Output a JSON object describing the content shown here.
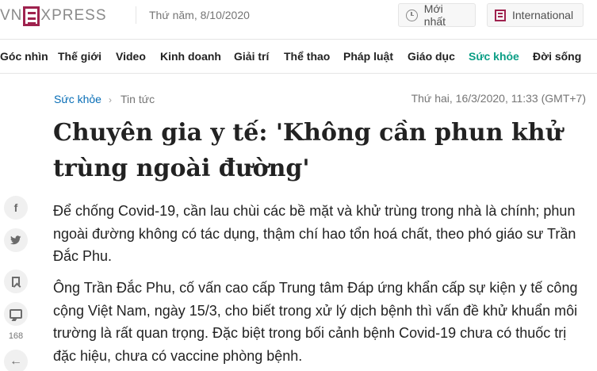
{
  "header": {
    "logo": {
      "left": "VN",
      "right": "XPRESS"
    },
    "date": "Thứ năm, 8/10/2020",
    "latest_button": "Mới nhất",
    "international_button": "International"
  },
  "nav": {
    "items": [
      "Góc nhìn",
      "Thế giới",
      "Video",
      "Kinh doanh",
      "Giải trí",
      "Thể thao",
      "Pháp luật",
      "Giáo dục",
      "Sức khỏe",
      "Đời sống"
    ]
  },
  "article": {
    "breadcrumb": {
      "section": "Sức khỏe",
      "subsection": "Tin tức"
    },
    "published": "Thứ hai, 16/3/2020, 11:33 (GMT+7)",
    "title": "Chuyên gia y tế: 'Không cần phun khử trùng ngoài đường'",
    "lead": "Để chống Covid-19, cần lau chùi các bề mặt và khử trùng trong nhà là chính; phun ngoài đường không có tác dụng, thậm chí hao tổn hoá chất, theo phó giáo sư Trần Đắc Phu.",
    "paragraph_1": "Ông Trần Đắc Phu, cố vấn cao cấp Trung tâm Đáp ứng khẩn cấp sự kiện y tế công cộng Việt Nam, ngày 15/3, cho biết trong xử lý dịch bệnh thì vấn đề khử khuẩn môi trường là rất quan trọng. Đặc biệt trong bối cảnh bệnh Covid-19 chưa có thuốc trị đặc hiệu, chưa có vaccine phòng bệnh."
  },
  "social": {
    "facebook_glyph": "f",
    "comment_count": "168",
    "back_glyph": "←"
  },
  "colors": {
    "brand": "#9f224e",
    "link": "#076db6",
    "health_section": "#0a9e85"
  }
}
